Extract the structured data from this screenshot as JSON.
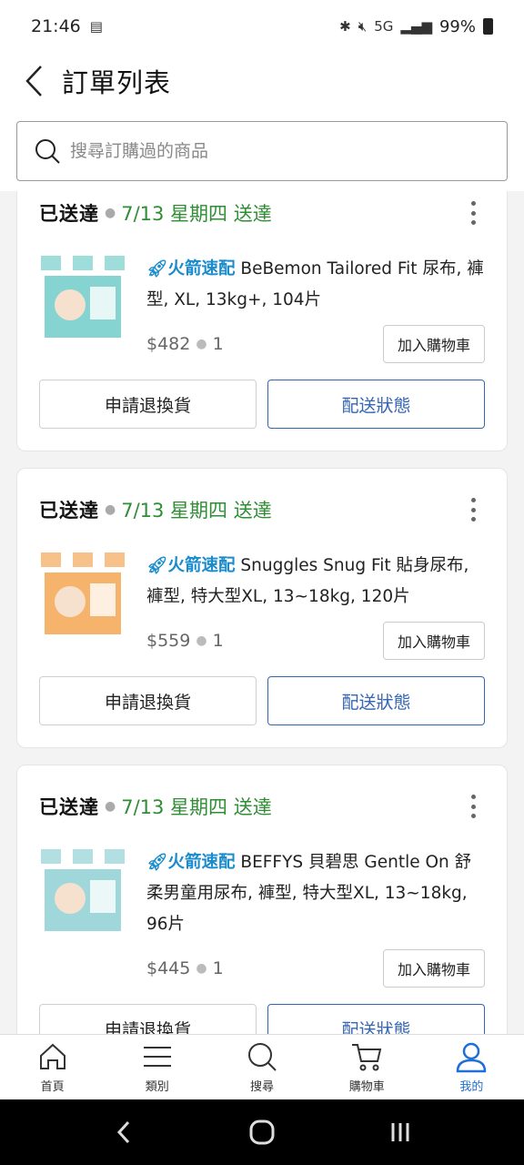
{
  "status_bar": {
    "time": "21:46",
    "network": "5G",
    "battery": "99%"
  },
  "header": {
    "title": "訂單列表"
  },
  "search": {
    "placeholder": "搜尋訂購過的商品"
  },
  "orders": [
    {
      "status": "已送達",
      "date": "7/13 星期四 送達",
      "badge": "火箭速配",
      "title": "BeBemon Tailored Fit 尿布, 褲型, XL, 13kg+, 104片",
      "price": "$482",
      "qty": "1",
      "add_cart": "加入購物車",
      "return_btn": "申請退換貨",
      "track_btn": "配送狀態",
      "thumb_color": "#5ec6c2"
    },
    {
      "status": "已送達",
      "date": "7/13 星期四 送達",
      "badge": "火箭速配",
      "title": "Snuggles Snug Fit 貼身尿布, 褲型, 特大型XL, 13~18kg, 120片",
      "price": "$559",
      "qty": "1",
      "add_cart": "加入購物車",
      "return_btn": "申請退換貨",
      "track_btn": "配送狀態",
      "thumb_color": "#f29a3a"
    },
    {
      "status": "已送達",
      "date": "7/13 星期四 送達",
      "badge": "火箭速配",
      "title": "BEFFYS 貝碧思 Gentle On 舒柔男童用尿布, 褲型, 特大型XL, 13~18kg, 96片",
      "price": "$445",
      "qty": "1",
      "add_cart": "加入購物車",
      "return_btn": "申請退換貨",
      "track_btn": "配送狀態",
      "thumb_color": "#7fc9cf"
    }
  ],
  "bottom_nav": [
    {
      "label": "首頁",
      "icon": "home-icon"
    },
    {
      "label": "類別",
      "icon": "menu-icon"
    },
    {
      "label": "搜尋",
      "icon": "search-icon"
    },
    {
      "label": "購物車",
      "icon": "cart-icon"
    },
    {
      "label": "我的",
      "icon": "user-icon",
      "active": true
    }
  ],
  "colors": {
    "accent": "#1f6fd6",
    "delivered_green": "#2f8d34",
    "rocket_blue": "#1a8ccc",
    "track_blue": "#3566b5"
  }
}
